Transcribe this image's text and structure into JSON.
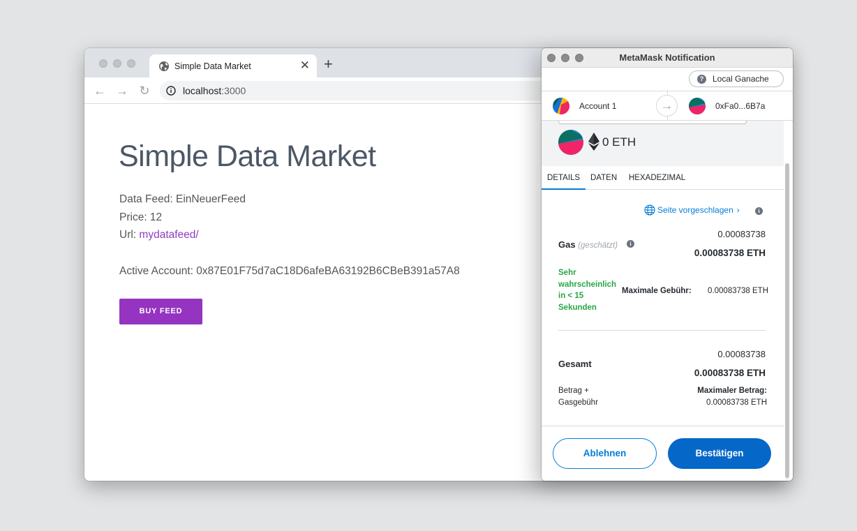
{
  "browser": {
    "tab_title": "Simple Data Market",
    "close_glyph": "✕",
    "new_tab_glyph": "+",
    "back_glyph": "←",
    "forward_glyph": "→",
    "reload_glyph": "↻",
    "url_host": "localhost",
    "url_port": ":3000"
  },
  "page": {
    "heading": "Simple Data Market",
    "data_feed": "Data Feed: EinNeuerFeed",
    "price": "Price: 12",
    "url_label": "Url: ",
    "url_link": "mydatafeed/",
    "active_account": "Active Account: 0x87E01F75d7aC18D6afeBA63192B6CBeB391a57A8",
    "buy_button": "BUY FEED",
    "accent_color": "#9534c0"
  },
  "metamask": {
    "window_title": "MetaMask Notification",
    "network": "Local Ganache",
    "network_help": "?",
    "from_account": "Account 1",
    "arrow_glyph": "→",
    "to_account": "0xFa0...6B7a",
    "amount": "0 ETH",
    "tabs": [
      "DETAILS",
      "DATEN",
      "HEXADEZIMAL"
    ],
    "suggested_site": "Seite vorgeschlagen",
    "suggested_chevron": "›",
    "info_glyph": "i",
    "gas": {
      "label": "Gas",
      "estimated": "(geschätzt)",
      "value": "0.00083738",
      "value_eth": "0.00083738 ETH",
      "likelihood": "Sehr wahrscheinlich in < 15 Sekunden",
      "max_fee_label": "Maximale Gebühr:",
      "max_fee_value": "0.00083738 ETH"
    },
    "total": {
      "label": "Gesamt",
      "value": "0.00083738",
      "value_eth": "0.00083738 ETH",
      "sub_label_1": "Betrag +",
      "sub_label_2": "Gasgebühr",
      "max_amount_label": "Maximaler Betrag:",
      "max_amount_value": "0.00083738 ETH"
    },
    "reject_button": "Ablehnen",
    "confirm_button": "Bestätigen",
    "primary_color": "#0568c8",
    "success_color": "#28a745"
  }
}
